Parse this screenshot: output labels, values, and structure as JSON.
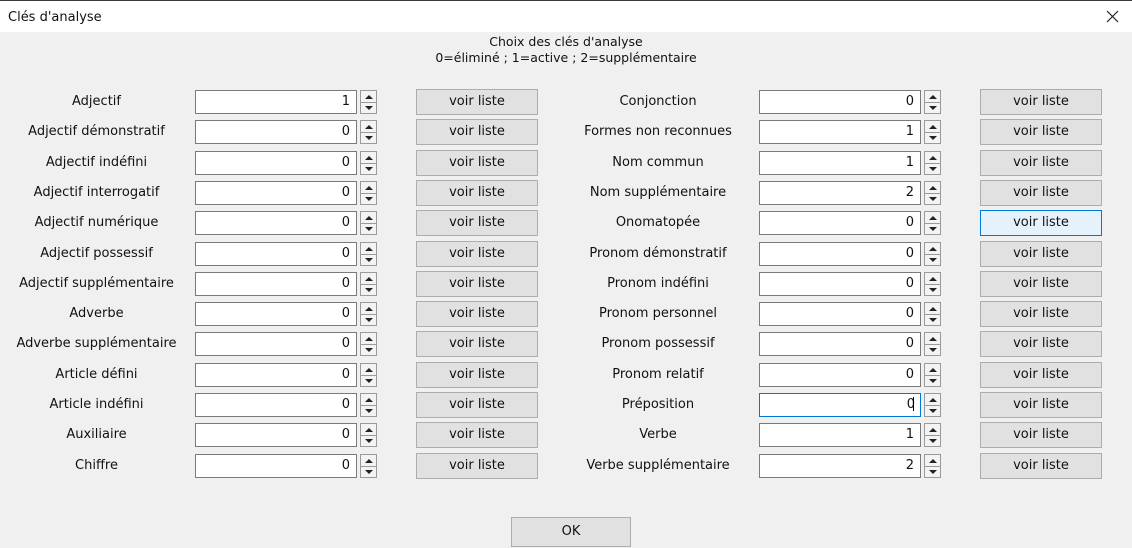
{
  "window": {
    "title": "Clés d'analyse"
  },
  "header": {
    "title": "Choix des clés d'analyse",
    "legend": "0=éliminé ; 1=active ; 2=supplémentaire"
  },
  "left_rows": [
    {
      "label": "Adjectif",
      "value": "1",
      "button": "voir liste"
    },
    {
      "label": "Adjectif démonstratif",
      "value": "0",
      "button": "voir liste"
    },
    {
      "label": "Adjectif indéfini",
      "value": "0",
      "button": "voir liste"
    },
    {
      "label": "Adjectif interrogatif",
      "value": "0",
      "button": "voir liste"
    },
    {
      "label": "Adjectif numérique",
      "value": "0",
      "button": "voir liste"
    },
    {
      "label": "Adjectif possessif",
      "value": "0",
      "button": "voir liste"
    },
    {
      "label": "Adjectif supplémentaire",
      "value": "0",
      "button": "voir liste"
    },
    {
      "label": "Adverbe",
      "value": "0",
      "button": "voir liste"
    },
    {
      "label": "Adverbe supplémentaire",
      "value": "0",
      "button": "voir liste"
    },
    {
      "label": "Article défini",
      "value": "0",
      "button": "voir liste"
    },
    {
      "label": "Article indéfini",
      "value": "0",
      "button": "voir liste"
    },
    {
      "label": "Auxiliaire",
      "value": "0",
      "button": "voir liste"
    },
    {
      "label": "Chiffre",
      "value": "0",
      "button": "voir liste"
    }
  ],
  "right_rows": [
    {
      "label": "Conjonction",
      "value": "0",
      "button": "voir liste"
    },
    {
      "label": "Formes non reconnues",
      "value": "1",
      "button": "voir liste"
    },
    {
      "label": "Nom commun",
      "value": "1",
      "button": "voir liste"
    },
    {
      "label": "Nom supplémentaire",
      "value": "2",
      "button": "voir liste"
    },
    {
      "label": "Onomatopée",
      "value": "0",
      "button": "voir liste"
    },
    {
      "label": "Pronom démonstratif",
      "value": "0",
      "button": "voir liste"
    },
    {
      "label": "Pronom indéfini",
      "value": "0",
      "button": "voir liste"
    },
    {
      "label": "Pronom personnel",
      "value": "0",
      "button": "voir liste"
    },
    {
      "label": "Pronom possessif",
      "value": "0",
      "button": "voir liste"
    },
    {
      "label": "Pronom relatif",
      "value": "0",
      "button": "voir liste"
    },
    {
      "label": "Préposition",
      "value": "0",
      "button": "voir liste"
    },
    {
      "label": "Verbe",
      "value": "1",
      "button": "voir liste"
    },
    {
      "label": "Verbe supplémentaire",
      "value": "2",
      "button": "voir liste"
    }
  ],
  "ok_label": "OK",
  "icons": {
    "close": "close-icon",
    "spin_up": "spin-up-icon",
    "spin_down": "spin-down-icon"
  },
  "colors": {
    "focus_border": "#0078d7",
    "hover_bg": "#e5f1fb",
    "button_bg": "#e1e1e1"
  }
}
